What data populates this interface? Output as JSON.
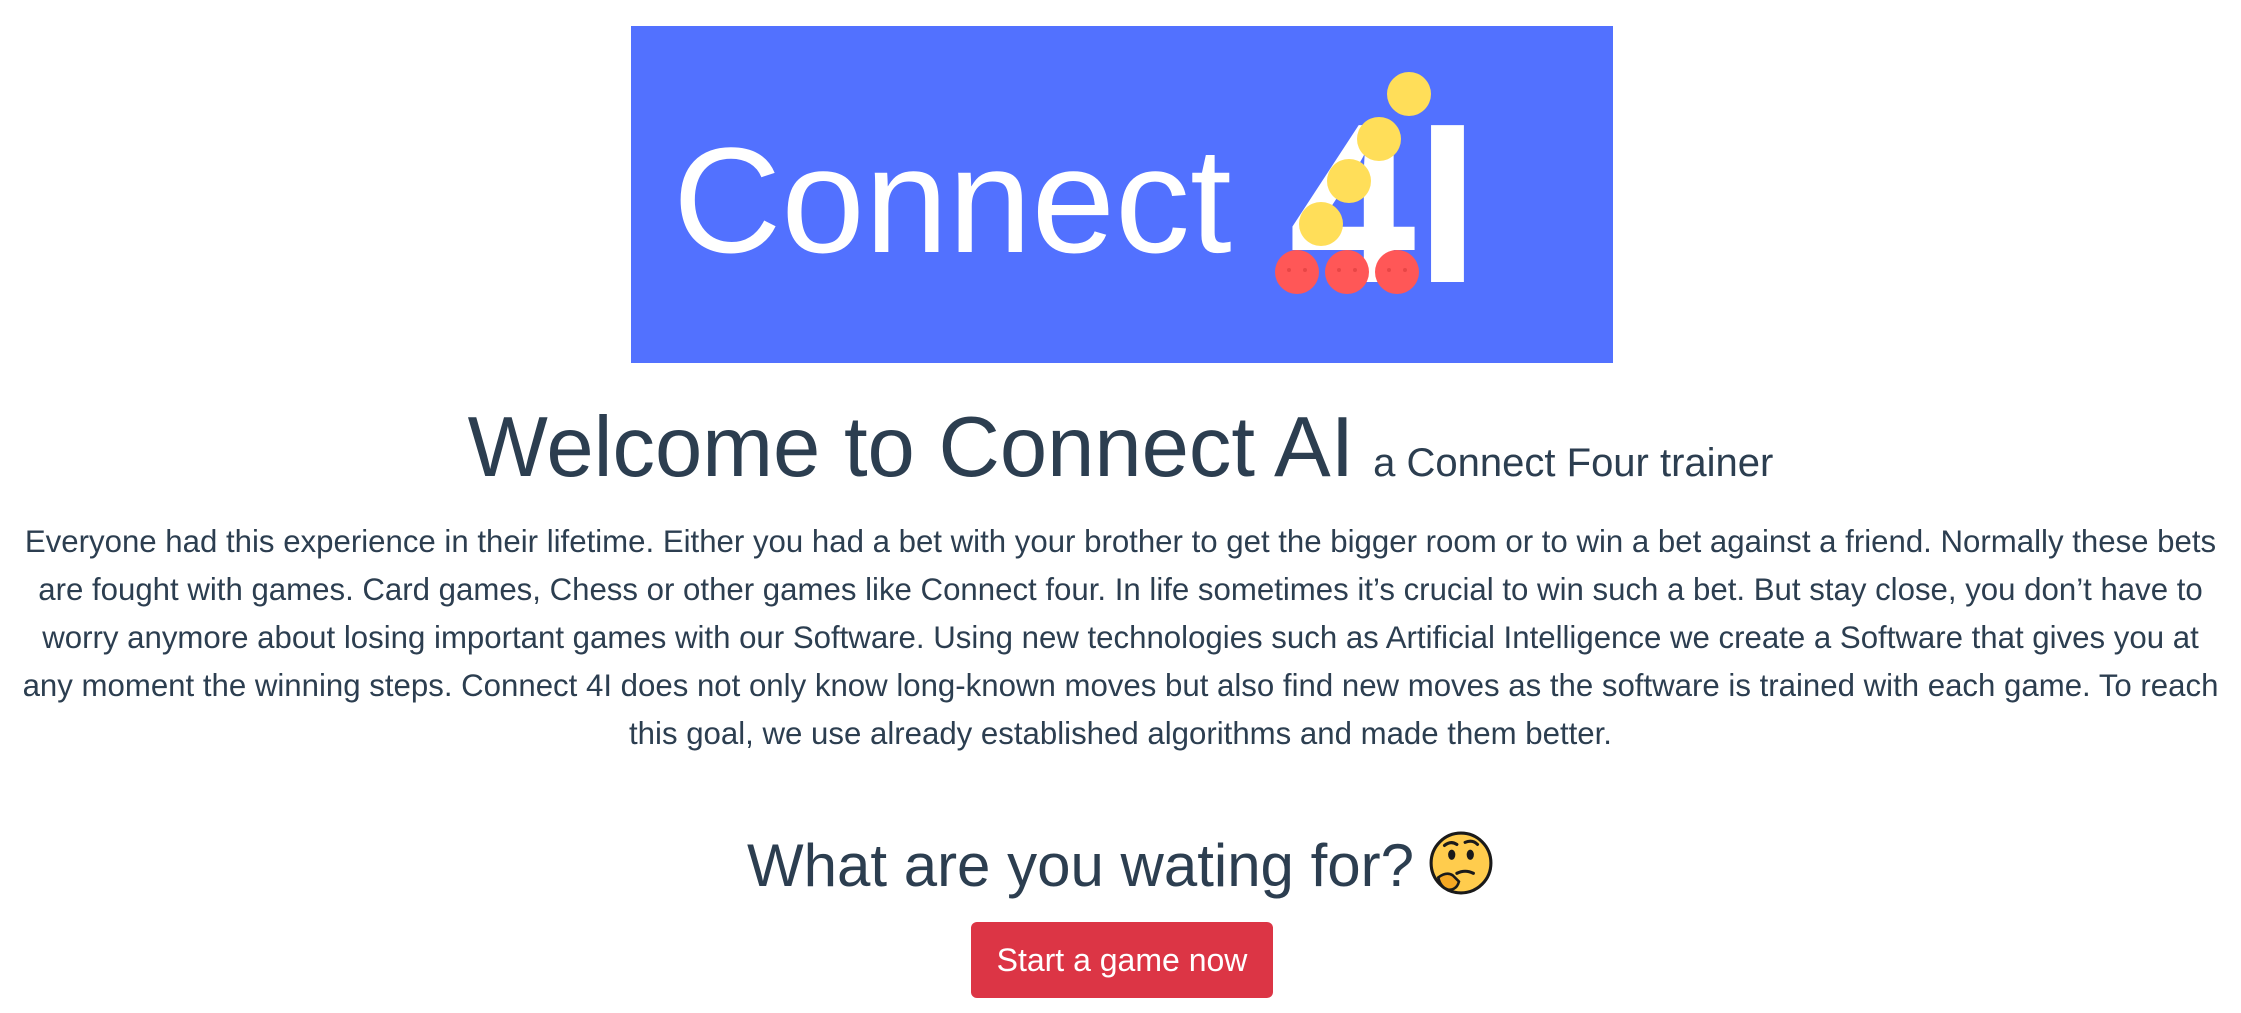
{
  "logo": {
    "text": "Connect",
    "brand_mark": "4I",
    "background_color": "#5271ff",
    "piece_colors": {
      "yellow": "#ffde59",
      "red": "#ff5757"
    }
  },
  "header": {
    "title": "Welcome to Connect AI",
    "subtitle": "a Connect Four trainer"
  },
  "description": "Everyone had this experience in their lifetime. Either you had a bet with your brother to get the bigger room or to win a bet against a friend. Normally these bets are fought with games. Card games, Chess or other games like Connect four. In life sometimes it’s crucial to win such a bet. But stay close, you don’t have to worry anymore about losing important games with our Software. Using new technologies such as Artificial Intelligence we create a Software that gives you at any moment the winning steps. Connect 4I does not only know long-known moves but also find new moves as the software is trained with each game. To reach this goal, we use already established algorithms and made them better.",
  "cta": {
    "question": "What are you wating for?",
    "emoji": "thinking-face-icon",
    "button_label": "Start a game now",
    "button_color": "#dc3545"
  },
  "colors": {
    "text": "#2c3e50",
    "background": "#ffffff"
  }
}
